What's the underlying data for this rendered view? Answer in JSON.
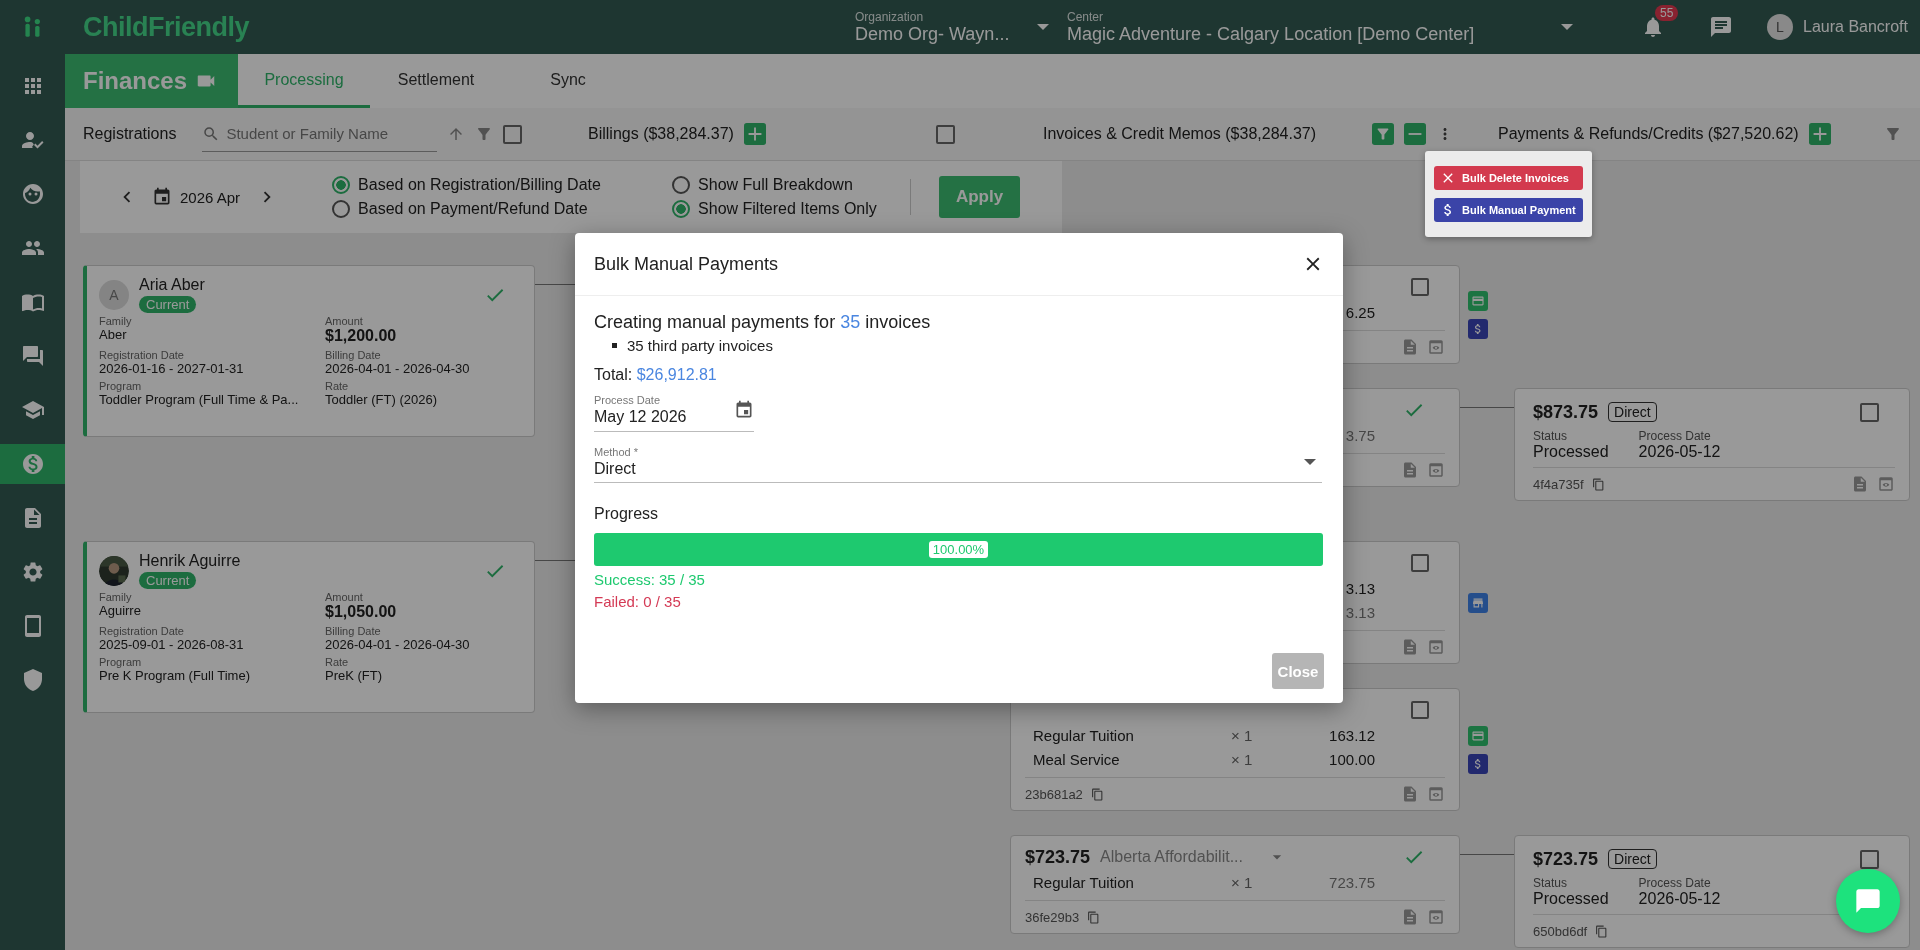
{
  "brand": {
    "name": "ChildFriendly"
  },
  "sidebar": {
    "items": [
      {
        "kind": "apps",
        "selected": false
      },
      {
        "kind": "attendance",
        "selected": false
      },
      {
        "kind": "face",
        "selected": false
      },
      {
        "kind": "people",
        "selected": false
      },
      {
        "kind": "book",
        "selected": false
      },
      {
        "kind": "forum",
        "selected": false
      },
      {
        "kind": "school",
        "selected": false
      },
      {
        "kind": "finance",
        "selected": true
      },
      {
        "kind": "document",
        "selected": false
      },
      {
        "kind": "settings",
        "selected": false
      },
      {
        "kind": "tablet",
        "selected": false
      },
      {
        "kind": "security",
        "selected": false
      }
    ]
  },
  "topbar": {
    "organization": {
      "label": "Organization",
      "value": "Demo Org- Wayn..."
    },
    "center": {
      "label": "Center",
      "value": "Magic Adventure - Calgary Location [Demo Center]"
    },
    "notification_count": "55",
    "user": {
      "initial": "L",
      "name": "Laura Bancroft"
    }
  },
  "page": {
    "title": "Finances",
    "tabs": [
      {
        "label": "Processing",
        "selected": true
      },
      {
        "label": "Settlement",
        "selected": false
      },
      {
        "label": "Sync",
        "selected": false
      }
    ]
  },
  "toolbar": {
    "registrations": {
      "title": "Registrations",
      "search_placeholder": "Student or Family Name",
      "checked": false
    },
    "billings": {
      "title": "Billings ($38,284.37)",
      "checked": false
    },
    "invoices": {
      "title": "Invoices & Credit Memos ($38,284.37)"
    },
    "payments": {
      "title": "Payments & Refunds/Credits ($27,520.62)"
    }
  },
  "filters": {
    "period": "2026 Apr",
    "date_basis": [
      {
        "label": "Based on Registration/Billing Date",
        "selected": true
      },
      {
        "label": "Based on Payment/Refund Date",
        "selected": false
      }
    ],
    "display": [
      {
        "label": "Show Full Breakdown",
        "selected": false
      },
      {
        "label": "Show Filtered Items Only",
        "selected": true
      }
    ],
    "apply": "Apply"
  },
  "invoice_menu": [
    {
      "kind": "delete",
      "label": "Bulk Delete Invoices"
    },
    {
      "kind": "payment",
      "label": "Bulk Manual Payment"
    }
  ],
  "registrations": [
    {
      "avatar": {
        "kind": "initial",
        "initial": "A"
      },
      "name": "Aria Aber",
      "status": "Current",
      "done": true,
      "fields": [
        {
          "label": "Family",
          "value": "Aber"
        },
        {
          "label": "Amount",
          "value": "$1,200.00",
          "kind": "amount"
        },
        {
          "label": "Registration Date",
          "value": "2026-01-16 - 2027-01-31"
        },
        {
          "label": "Billing Date",
          "value": "2026-04-01 - 2026-04-30"
        },
        {
          "label": "Program",
          "value": "Toddler Program (Full Time & Pa..."
        },
        {
          "label": "Rate",
          "value": "Toddler (FT) (2026)"
        }
      ],
      "invoices": [
        {
          "done": false,
          "checked": false,
          "lines": [
            {
              "amount": "6.25",
              "muted": false
            }
          ],
          "markers": [
            {
              "kind": "card"
            },
            {
              "kind": "payment"
            }
          ]
        },
        {
          "done": true,
          "lines": [
            {
              "amount": "3.75",
              "muted": true
            }
          ],
          "payment": {
            "amount": "$873.75",
            "method": "Direct",
            "checked": false,
            "actions": true,
            "fields": [
              {
                "label": "Status",
                "value": "Processed"
              },
              {
                "label": "Process Date",
                "value": "2026-05-12"
              }
            ],
            "id": "4f4a735f"
          }
        }
      ]
    },
    {
      "name": "Henrik Aguirre",
      "status": "Current",
      "done": true,
      "fields": [
        {
          "label": "Family",
          "value": "Aguirre"
        },
        {
          "label": "Amount",
          "value": "$1,050.00",
          "kind": "amount"
        },
        {
          "label": "Registration Date",
          "value": "2025-09-01 - 2026-08-31"
        },
        {
          "label": "Billing Date",
          "value": "2026-04-01 - 2026-04-30"
        },
        {
          "label": "Program",
          "value": "Pre K Program (Full Time)"
        },
        {
          "label": "Rate",
          "value": "PreK (FT)"
        }
      ],
      "invoices": [
        {
          "done": false,
          "checked": false,
          "lines": [
            {
              "amount": "3.13",
              "muted": false
            },
            {
              "amount": "3.13",
              "muted": true
            }
          ],
          "markers": [
            {
              "kind": "store"
            }
          ]
        },
        {
          "done": false,
          "checked": false,
          "lines": [
            {
              "name": "Regular Tuition",
              "qty": "× 1",
              "amount": "163.12",
              "muted": false
            },
            {
              "name": "Meal Service",
              "qty": "× 1",
              "amount": "100.00",
              "muted": false
            }
          ],
          "id": "23b681a2",
          "markers": [
            {
              "kind": "card"
            },
            {
              "kind": "payment"
            }
          ]
        },
        {
          "done": true,
          "total": "$723.75",
          "funder": "Alberta Affordabilit...",
          "lines": [
            {
              "name": "Regular Tuition",
              "qty": "× 1",
              "amount": "723.75",
              "muted": true
            }
          ],
          "id": "36fe29b3",
          "payment": {
            "amount": "$723.75",
            "method": "Direct",
            "checked": false,
            "actions": false,
            "fields": [
              {
                "label": "Status",
                "value": "Processed"
              },
              {
                "label": "Process Date",
                "value": "2026-05-12"
              }
            ],
            "id": "650bd6df"
          }
        }
      ]
    }
  ],
  "modal": {
    "title": "Bulk Manual Payments",
    "summary": {
      "prefix": "Creating manual payments for",
      "count": "35",
      "suffix": "invoices"
    },
    "breakdown": [
      "35 third party invoices"
    ],
    "total": {
      "label": "Total:",
      "value": "$26,912.81"
    },
    "process_date": {
      "label": "Process Date",
      "value": "May 12 2026"
    },
    "method": {
      "label": "Method *",
      "value": "Direct"
    },
    "progress": {
      "label": "Progress",
      "level": 1,
      "reading": "100.00%"
    },
    "results": [
      {
        "kind": "success",
        "text": "Success: 35 / 35"
      },
      {
        "kind": "failed",
        "text": "Failed: 0 / 35"
      }
    ],
    "close": "Close"
  }
}
